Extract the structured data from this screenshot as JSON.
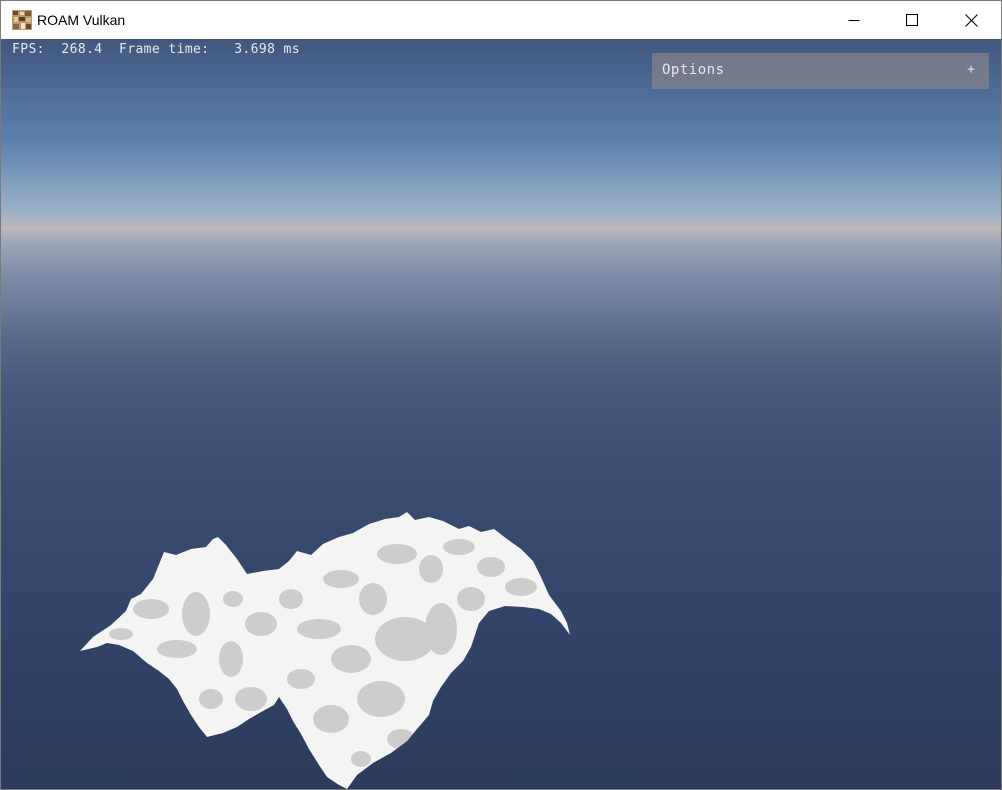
{
  "window": {
    "title": "ROAM Vulkan",
    "icon": "app-icon",
    "controls": {
      "minimize": "minimize-icon",
      "maximize": "maximize-icon",
      "close": "close-icon"
    }
  },
  "hud": {
    "fps_label": "FPS:",
    "fps_value": "268.4",
    "frame_time_label": "Frame time:",
    "frame_time_value": "3.698 ms"
  },
  "options_panel": {
    "label": "Options",
    "toggle": "+"
  },
  "colors": {
    "sky_top": "#41577e",
    "horizon": "#c0b6bc",
    "sky_bottom": "#2c3b5d",
    "terrain_light": "#f4f4f4",
    "terrain_shadow": "#cfcfcf"
  }
}
